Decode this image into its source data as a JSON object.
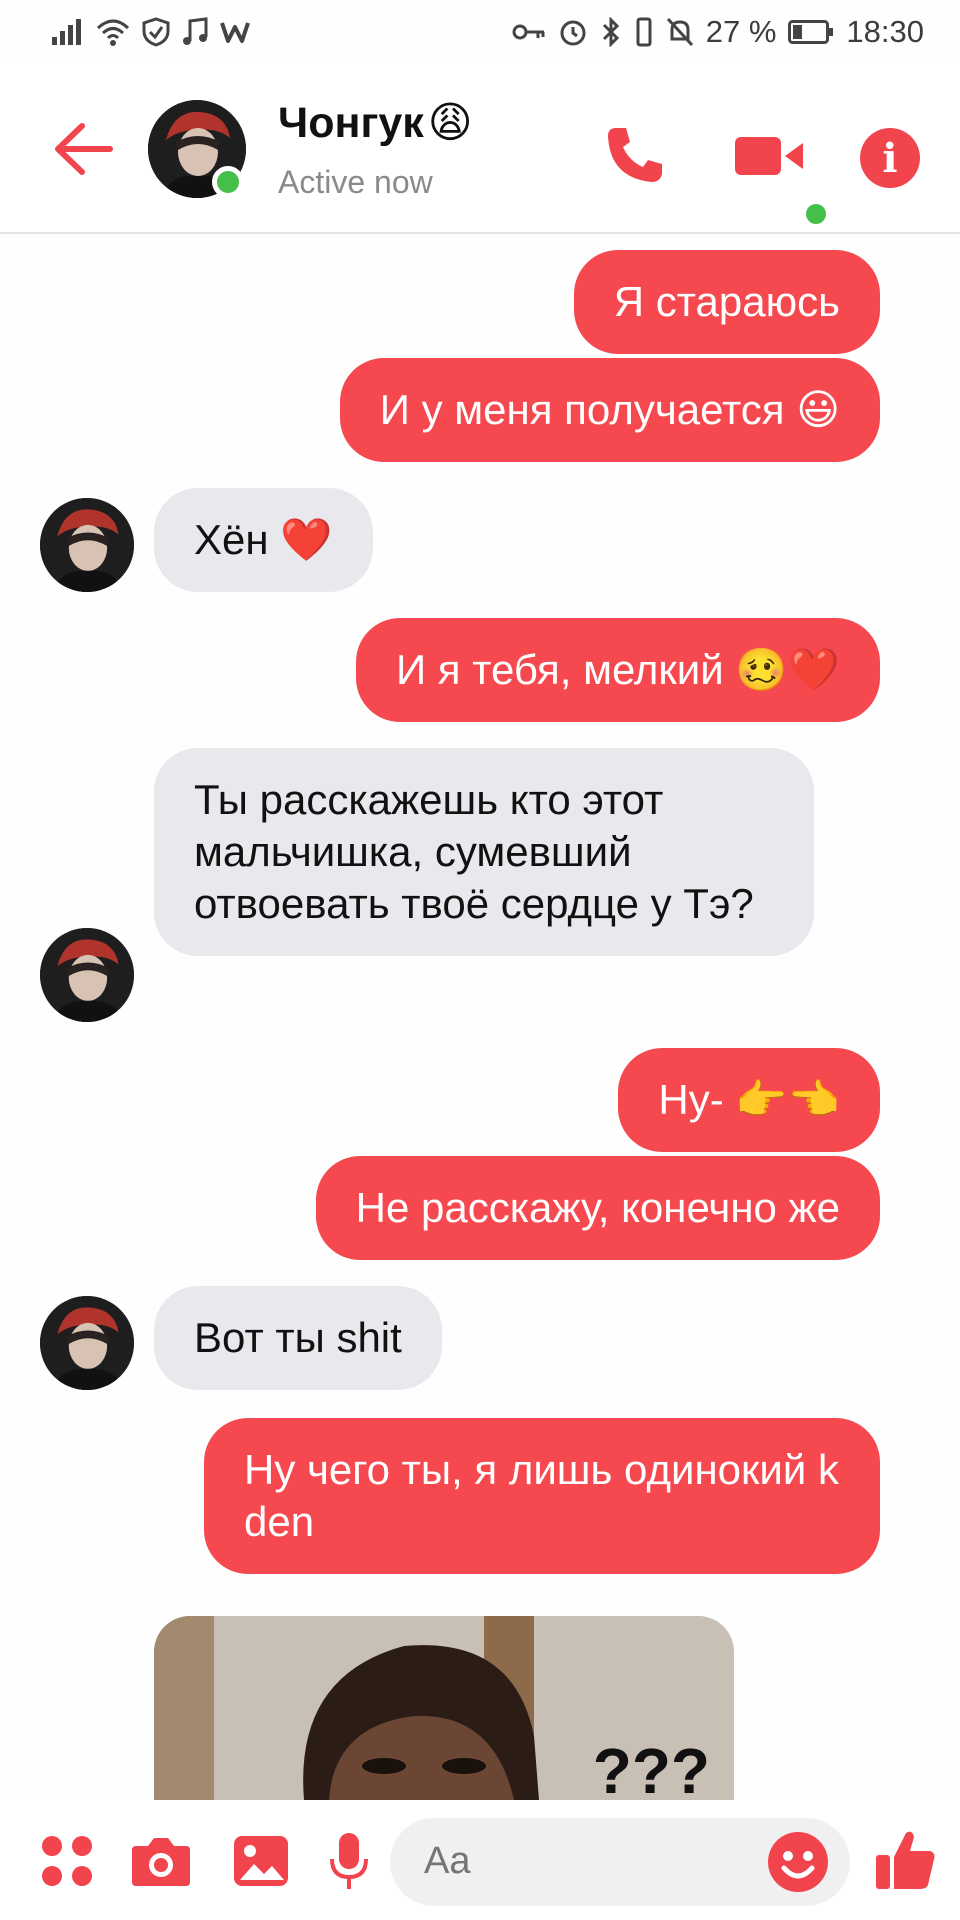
{
  "status_bar": {
    "battery": "27 %",
    "time": "18:30"
  },
  "header": {
    "contact_name": "Чонгук",
    "contact_emoji": "😩",
    "status": "Active now"
  },
  "messages": [
    {
      "dir": "out",
      "text": "Я стараюсь"
    },
    {
      "dir": "out",
      "text": "И у меня получается 😃"
    },
    {
      "dir": "in",
      "text": "Хён ❤️"
    },
    {
      "dir": "out",
      "text": "И я тебя, мелкий 🥴❤️"
    },
    {
      "dir": "in",
      "text": "Ты расскажешь кто этот мальчишка, сумевший отвоевать твоё сердце у Тэ?"
    },
    {
      "dir": "out",
      "text": "Ну- 👉👈"
    },
    {
      "dir": "out",
      "text": "Не расскажу, конечно же"
    },
    {
      "dir": "in",
      "text": "Вот ты shit"
    },
    {
      "dir": "out",
      "text": "Ну чего ты, я лишь одинокий k den"
    }
  ],
  "media": {
    "caption": "???"
  },
  "composer": {
    "placeholder": "Aa"
  },
  "colors": {
    "accent": "#f5484f",
    "incoming_bubble": "#e9e8ec",
    "online": "#44c04a"
  }
}
